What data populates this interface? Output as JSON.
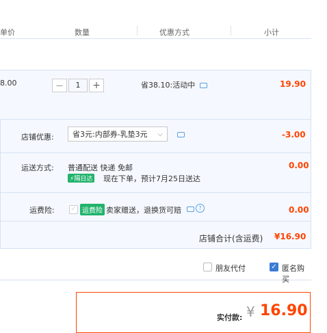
{
  "header": {
    "unit_price": "单价",
    "quantity": "数量",
    "discount_method": "优惠方式",
    "subtotal": "小计"
  },
  "item": {
    "unit_price": "8.00",
    "quantity": "1",
    "minus": "—",
    "plus": "+",
    "discount": "省38.10:活动中",
    "subtotal": "19.90"
  },
  "shop_discount": {
    "label": "店铺优惠:",
    "selected": "省3元:内部券-乳垫3元",
    "amount": "-3.00"
  },
  "shipping": {
    "label": "运送方式:",
    "method": "普通配送 快递 免邮",
    "badge": "隔日达",
    "note": "现在下单，预计7月25日送达",
    "amount": "0.00"
  },
  "insurance": {
    "label": "运费险:",
    "badge": "运费险",
    "text": "卖家赠送，退换货可赔",
    "amount": "0.00"
  },
  "shop_total": {
    "label": "店铺合计(含运费)",
    "amount": "¥16.90"
  },
  "options": {
    "friend_pay": "朋友代付",
    "anonymous": "匿名购买"
  },
  "payment": {
    "label": "实付款:",
    "currency": "¥",
    "amount": "16.90"
  },
  "colors": {
    "price_red": "#ff4400",
    "row_bg": "#f5f8fe",
    "border": "#d6e2f3",
    "checkbox_blue": "#3a7bd5",
    "badge_green": "#21b36c"
  }
}
